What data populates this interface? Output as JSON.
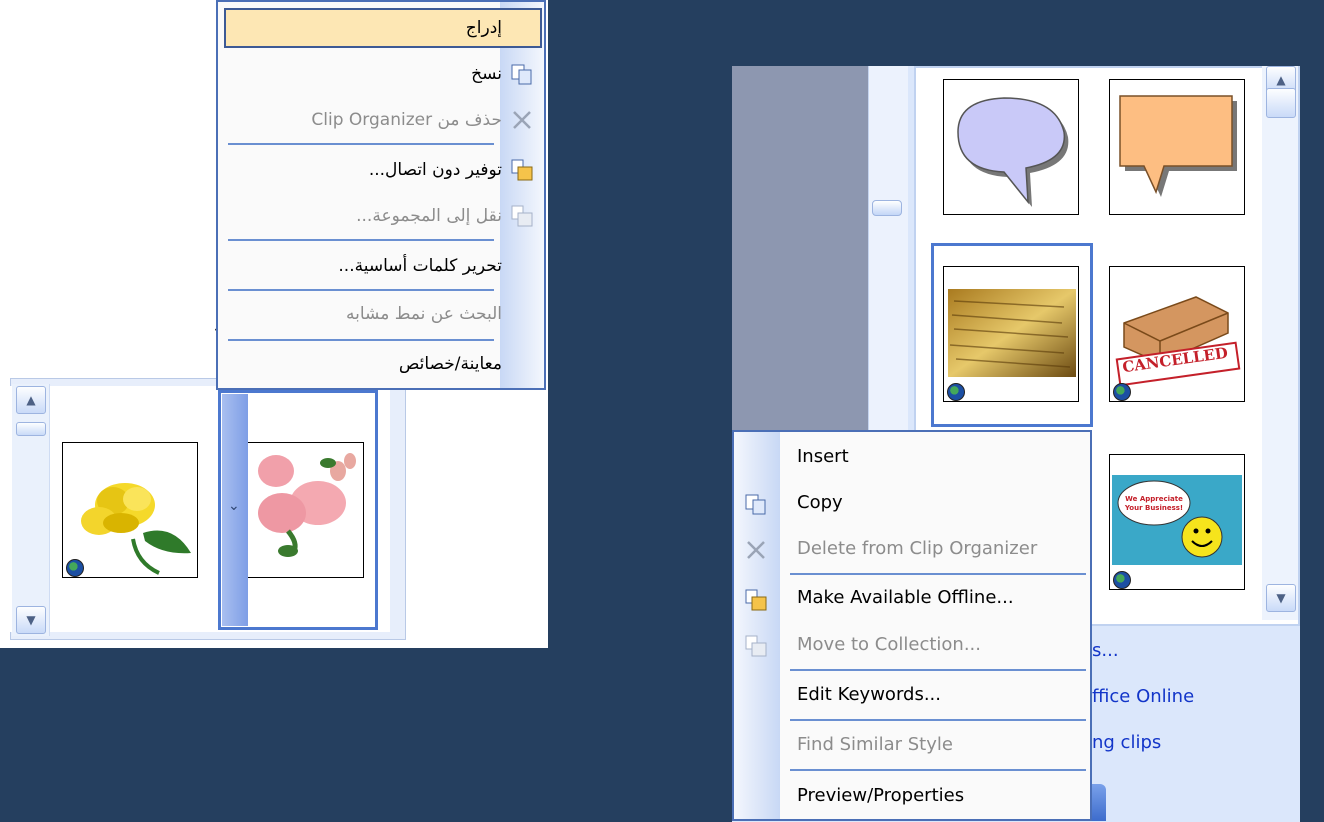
{
  "arabic_menu": {
    "items": [
      {
        "label": "إدراج",
        "state": "highlighted"
      },
      {
        "label": "نسخ",
        "state": "enabled",
        "icon": "copy-icon"
      },
      {
        "label": "حذف من Clip Organizer",
        "state": "disabled",
        "icon": "delete-x-icon"
      },
      {
        "label": "توفير دون اتصال...",
        "state": "enabled",
        "icon": "make-offline-icon"
      },
      {
        "label": "نقل إلى المجموعة...",
        "state": "disabled",
        "icon": "move-collection-icon"
      },
      {
        "label": "تحرير كلمات أساسية...",
        "state": "enabled"
      },
      {
        "label": "البحث عن نمط مشابه",
        "state": "disabled"
      },
      {
        "label": "معاينة/خصائص",
        "state": "enabled"
      }
    ]
  },
  "english_menu": {
    "items": [
      {
        "label": "Insert",
        "state": "enabled"
      },
      {
        "label": "Copy",
        "state": "enabled",
        "icon": "copy-icon"
      },
      {
        "label": "Delete from Clip Organizer",
        "state": "disabled",
        "icon": "delete-x-icon"
      },
      {
        "label": "Make Available Offline...",
        "state": "enabled",
        "icon": "make-offline-icon"
      },
      {
        "label": "Move to Collection...",
        "state": "disabled",
        "icon": "move-collection-icon"
      },
      {
        "label": "Edit Keywords...",
        "state": "enabled"
      },
      {
        "label": "Find Similar Style",
        "state": "disabled"
      },
      {
        "label": "Preview/Properties",
        "state": "enabled"
      }
    ]
  },
  "task_pane_links": {
    "link1": "s...",
    "link2": "ffice Online",
    "link3": "ng clips"
  },
  "clips": {
    "thumb1": "Cancelled",
    "thumb2_line1": "We Appreciate",
    "thumb2_line2": "Your Business!"
  },
  "background_fragments": [
    "ة",
    "ة",
    "ر"
  ],
  "colors": {
    "page_bg": "#253f5f",
    "menu_border": "#4b6fb6",
    "highlight": "#fde7b4",
    "link": "#1235c9",
    "disabled_text": "#8c8c8c"
  }
}
